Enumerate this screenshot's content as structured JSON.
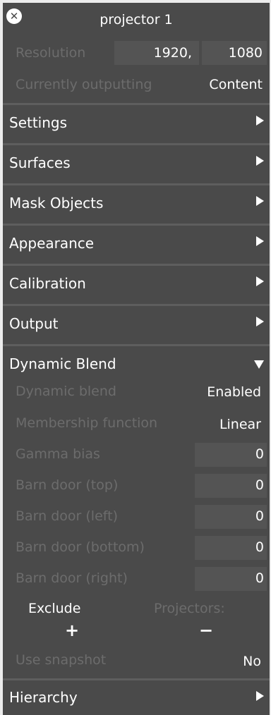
{
  "window": {
    "title": "projector 1"
  },
  "info": {
    "resolution_label": "Resolution",
    "resolution_w": "1920,",
    "resolution_h": "1080",
    "outputting_label": "Currently outputting",
    "outputting_value": "Content"
  },
  "sections": {
    "settings": "Settings",
    "surfaces": "Surfaces",
    "mask_objects": "Mask Objects",
    "appearance": "Appearance",
    "calibration": "Calibration",
    "output": "Output",
    "dynamic_blend": "Dynamic Blend",
    "hierarchy": "Hierarchy"
  },
  "dynamic_blend": {
    "dynamic_blend_label": "Dynamic blend",
    "dynamic_blend_value": "Enabled",
    "membership_label": "Membership function",
    "membership_value": "Linear",
    "gamma_label": "Gamma bias",
    "gamma_value": "0",
    "barn_top_label": "Barn door (top)",
    "barn_top_value": "0",
    "barn_left_label": "Barn door (left)",
    "barn_left_value": "0",
    "barn_bottom_label": "Barn door (bottom)",
    "barn_bottom_value": "0",
    "barn_right_label": "Barn door (right)",
    "barn_right_value": "0",
    "exclude_label": "Exclude",
    "projectors_label": "Projectors:",
    "add_symbol": "+",
    "remove_symbol": "−",
    "snapshot_label": "Use snapshot",
    "snapshot_value": "No"
  },
  "icons": {
    "close": "close-icon",
    "expand": "triangle-right-icon",
    "collapse": "triangle-down-icon"
  },
  "colors": {
    "panel_bg": "#4a4a4a",
    "field_bg": "#545454",
    "divider": "#5e5e5e",
    "dim_text": "#6c6c6c",
    "text": "#ffffff",
    "page_bg": "#ececec"
  }
}
